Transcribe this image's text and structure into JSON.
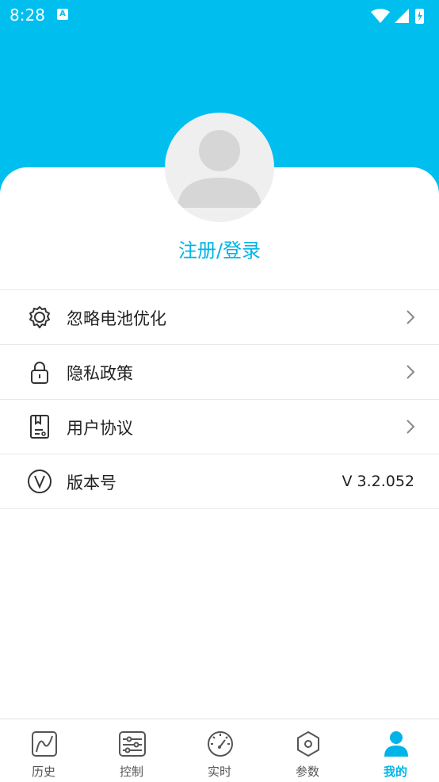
{
  "status_bar": {
    "time": "8:28",
    "notification_badge": "A"
  },
  "header": {
    "accent_color": "#00bfee"
  },
  "profile": {
    "login_label": "注册/登录",
    "avatar_icon": "user-placeholder-icon"
  },
  "menu": {
    "items": [
      {
        "label": "忽略电池优化",
        "icon": "gear-icon",
        "type": "link"
      },
      {
        "label": "隐私政策",
        "icon": "lock-icon",
        "type": "link"
      },
      {
        "label": "用户协议",
        "icon": "document-icon",
        "type": "link"
      },
      {
        "label": "版本号",
        "icon": "version-icon",
        "value": "V 3.2.052"
      }
    ]
  },
  "tabbar": {
    "active_color": "#00b4e8",
    "tabs": [
      {
        "label": "历史",
        "icon": "history-chart-icon"
      },
      {
        "label": "控制",
        "icon": "sliders-icon"
      },
      {
        "label": "实时",
        "icon": "gauge-icon"
      },
      {
        "label": "参数",
        "icon": "hexagon-icon"
      },
      {
        "label": "我的",
        "icon": "person-icon",
        "active": true
      }
    ]
  }
}
